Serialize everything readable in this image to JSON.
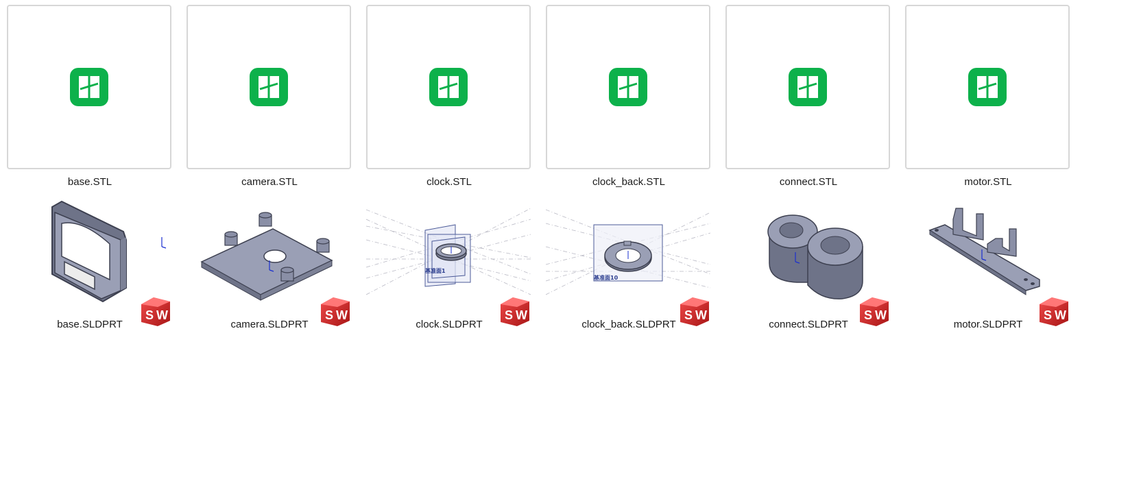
{
  "row1": [
    {
      "name": "base.STL",
      "icon": "stl-viewer-icon"
    },
    {
      "name": "camera.STL",
      "icon": "stl-viewer-icon"
    },
    {
      "name": "clock.STL",
      "icon": "stl-viewer-icon"
    },
    {
      "name": "clock_back.STL",
      "icon": "stl-viewer-icon"
    },
    {
      "name": "connect.STL",
      "icon": "stl-viewer-icon"
    },
    {
      "name": "motor.STL",
      "icon": "stl-viewer-icon"
    }
  ],
  "row2": [
    {
      "name": "base.SLDPRT",
      "icon": "solidworks-icon"
    },
    {
      "name": "camera.SLDPRT",
      "icon": "solidworks-icon"
    },
    {
      "name": "clock.SLDPRT",
      "icon": "solidworks-icon",
      "plane_label": "基准面1"
    },
    {
      "name": "clock_back.SLDPRT",
      "icon": "solidworks-icon",
      "plane_label": "基准面10"
    },
    {
      "name": "connect.SLDPRT",
      "icon": "solidworks-icon"
    },
    {
      "name": "motor.SLDPRT",
      "icon": "solidworks-icon"
    }
  ],
  "colors": {
    "stl_green": "#0db14b",
    "sw_red": "#d42b2b",
    "part_gray": "#8a8fa6"
  }
}
